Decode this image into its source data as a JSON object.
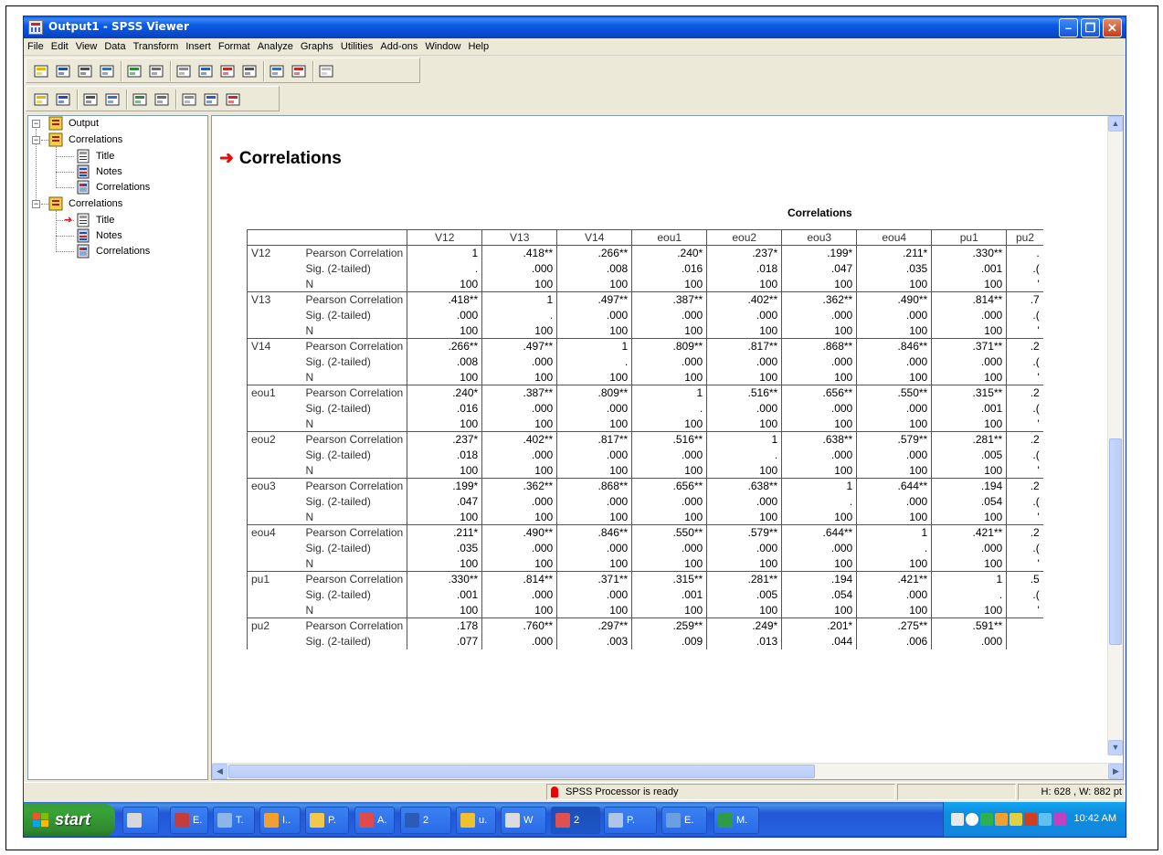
{
  "window": {
    "title": "Output1 - SPSS Viewer"
  },
  "menu": [
    "File",
    "Edit",
    "View",
    "Data",
    "Transform",
    "Insert",
    "Format",
    "Analyze",
    "Graphs",
    "Utilities",
    "Add-ons",
    "Window",
    "Help"
  ],
  "toolbar1": [
    "open-icon",
    "save-icon",
    "print-icon",
    "print-preview-icon",
    "export-icon",
    "dialog-recall-icon",
    "undo-icon",
    "goto-data-icon",
    "variables-icon",
    "use-sets-icon",
    "show-all-variables-icon",
    "designate-window-icon",
    "run-icon"
  ],
  "toolbar2": [
    "promote-icon",
    "demote-icon",
    "expand-icon",
    "collapse-icon",
    "show-icon",
    "hide-icon",
    "insert-heading-icon",
    "insert-title-icon",
    "insert-text-icon"
  ],
  "tree": {
    "root": "Output",
    "groups": [
      {
        "label": "Correlations",
        "items": [
          "Title",
          "Notes",
          "Correlations"
        ]
      },
      {
        "label": "Correlations",
        "items": [
          "Title",
          "Notes",
          "Correlations"
        ]
      }
    ]
  },
  "output": {
    "heading": "Correlations",
    "table_caption": "Correlations",
    "columns": [
      "V12",
      "V13",
      "V14",
      "eou1",
      "eou2",
      "eou3",
      "eou4",
      "pu1",
      "pu2"
    ],
    "stat_labels": [
      "Pearson Correlation",
      "Sig. (2-tailed)",
      "N"
    ],
    "rows": [
      {
        "var": "V12",
        "r": [
          "1",
          ".418**",
          ".266**",
          ".240*",
          ".237*",
          ".199*",
          ".211*",
          ".330**",
          "."
        ],
        "sig": [
          ".",
          ".000",
          ".008",
          ".016",
          ".018",
          ".047",
          ".035",
          ".001",
          ".("
        ],
        "n": [
          "100",
          "100",
          "100",
          "100",
          "100",
          "100",
          "100",
          "100",
          "'"
        ]
      },
      {
        "var": "V13",
        "r": [
          ".418**",
          "1",
          ".497**",
          ".387**",
          ".402**",
          ".362**",
          ".490**",
          ".814**",
          ".7"
        ],
        "sig": [
          ".000",
          ".",
          ".000",
          ".000",
          ".000",
          ".000",
          ".000",
          ".000",
          ".("
        ],
        "n": [
          "100",
          "100",
          "100",
          "100",
          "100",
          "100",
          "100",
          "100",
          "'"
        ]
      },
      {
        "var": "V14",
        "r": [
          ".266**",
          ".497**",
          "1",
          ".809**",
          ".817**",
          ".868**",
          ".846**",
          ".371**",
          ".2"
        ],
        "sig": [
          ".008",
          ".000",
          ".",
          ".000",
          ".000",
          ".000",
          ".000",
          ".000",
          ".("
        ],
        "n": [
          "100",
          "100",
          "100",
          "100",
          "100",
          "100",
          "100",
          "100",
          "'"
        ]
      },
      {
        "var": "eou1",
        "r": [
          ".240*",
          ".387**",
          ".809**",
          "1",
          ".516**",
          ".656**",
          ".550**",
          ".315**",
          ".2"
        ],
        "sig": [
          ".016",
          ".000",
          ".000",
          ".",
          ".000",
          ".000",
          ".000",
          ".001",
          ".("
        ],
        "n": [
          "100",
          "100",
          "100",
          "100",
          "100",
          "100",
          "100",
          "100",
          "'"
        ]
      },
      {
        "var": "eou2",
        "r": [
          ".237*",
          ".402**",
          ".817**",
          ".516**",
          "1",
          ".638**",
          ".579**",
          ".281**",
          ".2"
        ],
        "sig": [
          ".018",
          ".000",
          ".000",
          ".000",
          ".",
          ".000",
          ".000",
          ".005",
          ".("
        ],
        "n": [
          "100",
          "100",
          "100",
          "100",
          "100",
          "100",
          "100",
          "100",
          "'"
        ]
      },
      {
        "var": "eou3",
        "r": [
          ".199*",
          ".362**",
          ".868**",
          ".656**",
          ".638**",
          "1",
          ".644**",
          ".194",
          ".2"
        ],
        "sig": [
          ".047",
          ".000",
          ".000",
          ".000",
          ".000",
          ".",
          ".000",
          ".054",
          ".("
        ],
        "n": [
          "100",
          "100",
          "100",
          "100",
          "100",
          "100",
          "100",
          "100",
          "'"
        ]
      },
      {
        "var": "eou4",
        "r": [
          ".211*",
          ".490**",
          ".846**",
          ".550**",
          ".579**",
          ".644**",
          "1",
          ".421**",
          ".2"
        ],
        "sig": [
          ".035",
          ".000",
          ".000",
          ".000",
          ".000",
          ".000",
          ".",
          ".000",
          ".("
        ],
        "n": [
          "100",
          "100",
          "100",
          "100",
          "100",
          "100",
          "100",
          "100",
          "'"
        ]
      },
      {
        "var": "pu1",
        "r": [
          ".330**",
          ".814**",
          ".371**",
          ".315**",
          ".281**",
          ".194",
          ".421**",
          "1",
          ".5"
        ],
        "sig": [
          ".001",
          ".000",
          ".000",
          ".001",
          ".005",
          ".054",
          ".000",
          ".",
          ".("
        ],
        "n": [
          "100",
          "100",
          "100",
          "100",
          "100",
          "100",
          "100",
          "100",
          "'"
        ]
      },
      {
        "var": "pu2",
        "r": [
          ".178",
          ".760**",
          ".297**",
          ".259**",
          ".249*",
          ".201*",
          ".275**",
          ".591**",
          ""
        ],
        "sig": [
          ".077",
          ".000",
          ".003",
          ".009",
          ".013",
          ".044",
          ".006",
          ".000",
          ""
        ],
        "n": []
      }
    ]
  },
  "status": {
    "message": "SPSS Processor  is ready",
    "dims": "H: 628 , W: 882 pt"
  },
  "taskbar": {
    "start": "start",
    "tasks": [
      {
        "label": "",
        "color": "#d8d8d8"
      },
      {
        "label": "E.",
        "color": "#c43c3c"
      },
      {
        "label": "T.",
        "color": "#8fb4e8"
      },
      {
        "label": "I..",
        "color": "#f0a030"
      },
      {
        "label": "P.",
        "color": "#f2c84b"
      },
      {
        "label": "A.",
        "color": "#e04a4a"
      },
      {
        "label": "2",
        "color": "#2b5bb8"
      },
      {
        "label": "u.",
        "color": "#f0c030"
      },
      {
        "label": "W",
        "color": "#dcdcdc"
      },
      {
        "label": "2",
        "color": "#e05050"
      },
      {
        "label": "P.",
        "color": "#b0c4e8"
      },
      {
        "label": "E.",
        "color": "#6aa0e0"
      },
      {
        "label": "M.",
        "color": "#2e9a4a"
      }
    ],
    "clock": "10:42 AM"
  },
  "colors": {
    "titlebar": "#0a5be6",
    "heading_arrow": "#e01010",
    "taskbar": "#2157d7",
    "start": "#38a438"
  }
}
